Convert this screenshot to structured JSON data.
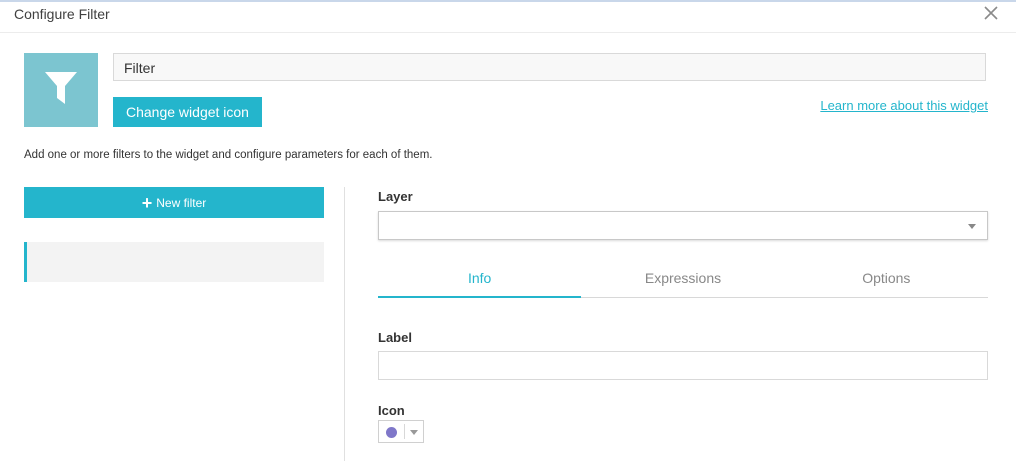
{
  "window": {
    "title": "Configure Filter"
  },
  "widget": {
    "name_value": "Filter",
    "change_icon_label": "Change widget icon",
    "learn_more_label": "Learn more about this widget",
    "description": "Add one or more filters to the widget and configure parameters for each of them."
  },
  "filters": {
    "new_filter_label": "New filter",
    "new_filter_icon": "plus-icon",
    "items": [
      {
        "label": ""
      }
    ]
  },
  "editor": {
    "layer_label": "Layer",
    "layer_value": "",
    "tabs": [
      {
        "label": "Info",
        "active": true
      },
      {
        "label": "Expressions",
        "active": false
      },
      {
        "label": "Options",
        "active": false
      }
    ],
    "label_label": "Label",
    "label_value": "",
    "icon_label": "Icon",
    "icon_color": "#7f77c9"
  },
  "colors": {
    "accent": "#24b5cc",
    "icon_tile": "#7cc5d0"
  }
}
